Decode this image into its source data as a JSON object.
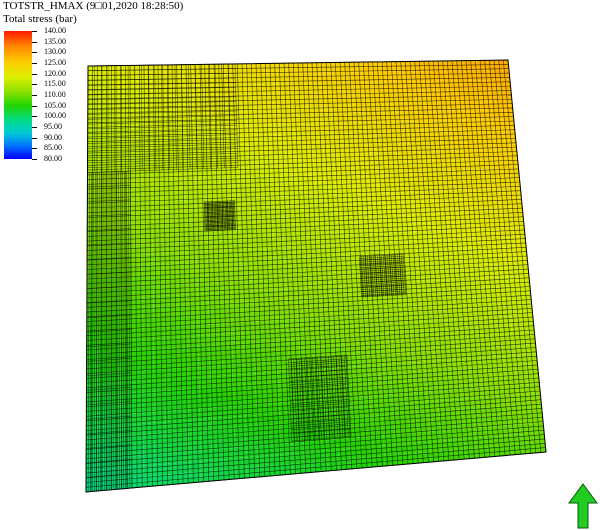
{
  "view": {
    "title": "TOTSTR_HMAX (9□01,2020 18:28:50)",
    "subtitle": "Total stress (bar)"
  },
  "legend": {
    "labels": [
      "140.00",
      "135.00",
      "130.00",
      "125.00",
      "120.00",
      "115.00",
      "110.00",
      "105.00",
      "100.00",
      "95.00",
      "90.00",
      "85.00",
      "80.00"
    ],
    "min": 80,
    "max": 140,
    "colors": {
      "high": "#ff1a00",
      "mid": "#22d400",
      "low": "#0000ff"
    }
  },
  "mesh": {
    "grid_color": "#000000"
  },
  "north_arrow": {
    "color": "#22cc22",
    "icon": "north-arrow-icon"
  }
}
